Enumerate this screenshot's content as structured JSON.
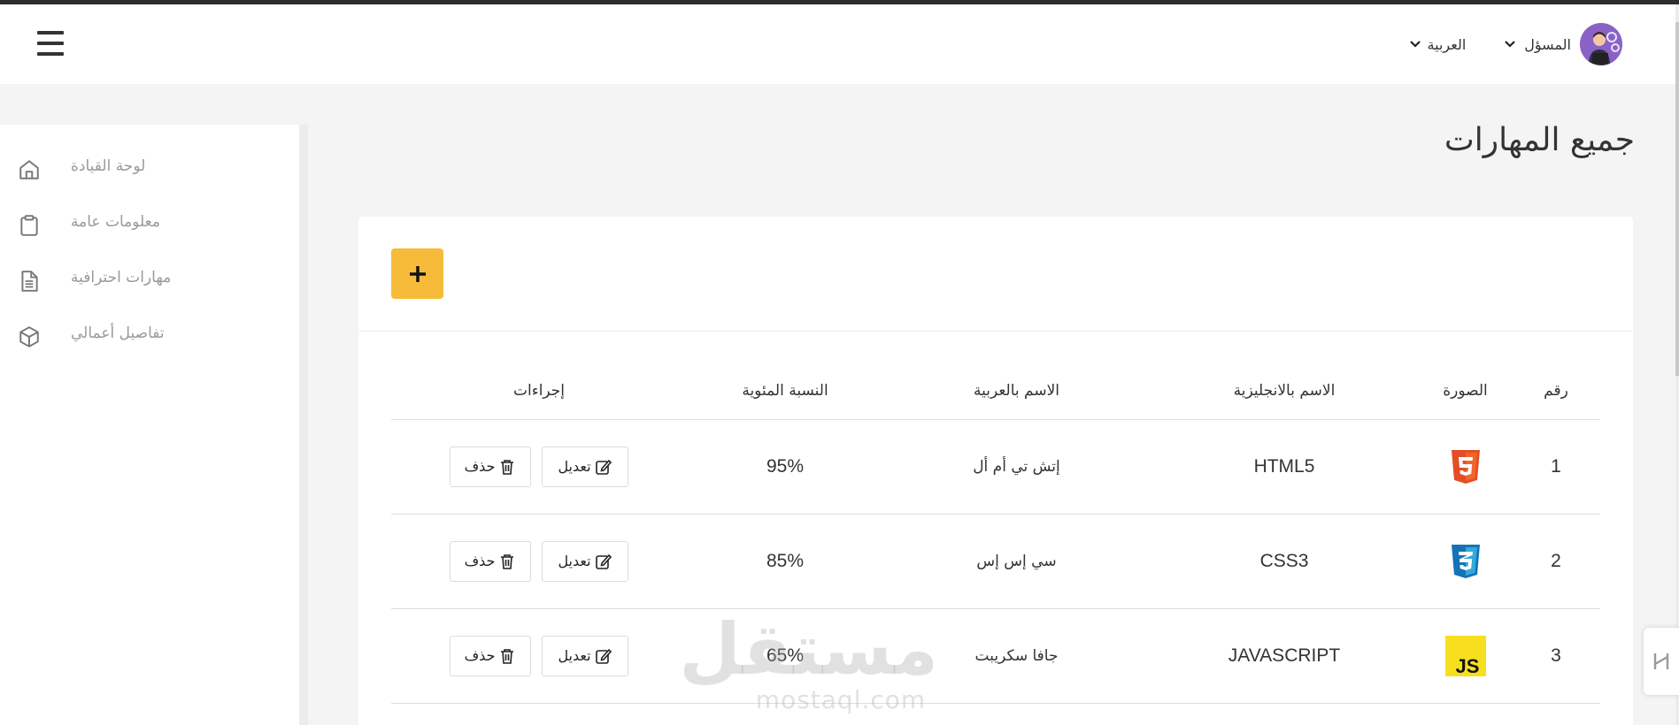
{
  "navbar": {
    "user_label": "المسؤل",
    "language_label": "العربية"
  },
  "sidebar": {
    "items": [
      {
        "label": "لوحة القيادة",
        "icon": "home-icon"
      },
      {
        "label": "معلومات عامة",
        "icon": "clipboard-icon"
      },
      {
        "label": "مهارات احترافية",
        "icon": "document-icon"
      },
      {
        "label": "تفاصيل أعمالي",
        "icon": "box-icon"
      }
    ]
  },
  "page": {
    "title": "جميع المهارات"
  },
  "toolbar": {
    "add_label": "+"
  },
  "table": {
    "headers": [
      "رقم",
      "الصورة",
      "الاسم بالانجليزية",
      "الاسم بالعربية",
      "النسبة المئوية",
      "إجراءات"
    ],
    "rows": [
      {
        "num": "1",
        "logo": "html5-logo-icon",
        "name_en": "HTML5",
        "name_ar": "إتش تي أم أل",
        "percent": "95%"
      },
      {
        "num": "2",
        "logo": "css3-logo-icon",
        "name_en": "CSS3",
        "name_ar": "سي إس إس",
        "percent": "85%"
      },
      {
        "num": "3",
        "logo": "javascript-logo-icon",
        "name_en": "JAVASCRIPT",
        "name_ar": "جافا سكريبت",
        "percent": "65%"
      }
    ],
    "edit_label": "تعديل",
    "delete_label": "حذف"
  },
  "watermark": {
    "arabic": "مستقل",
    "latin": "mostaql.com"
  },
  "colors": {
    "accent": "#f6bb39",
    "html5": "#e44d26",
    "css3": "#1572b6",
    "javascript": "#f7df1e"
  }
}
